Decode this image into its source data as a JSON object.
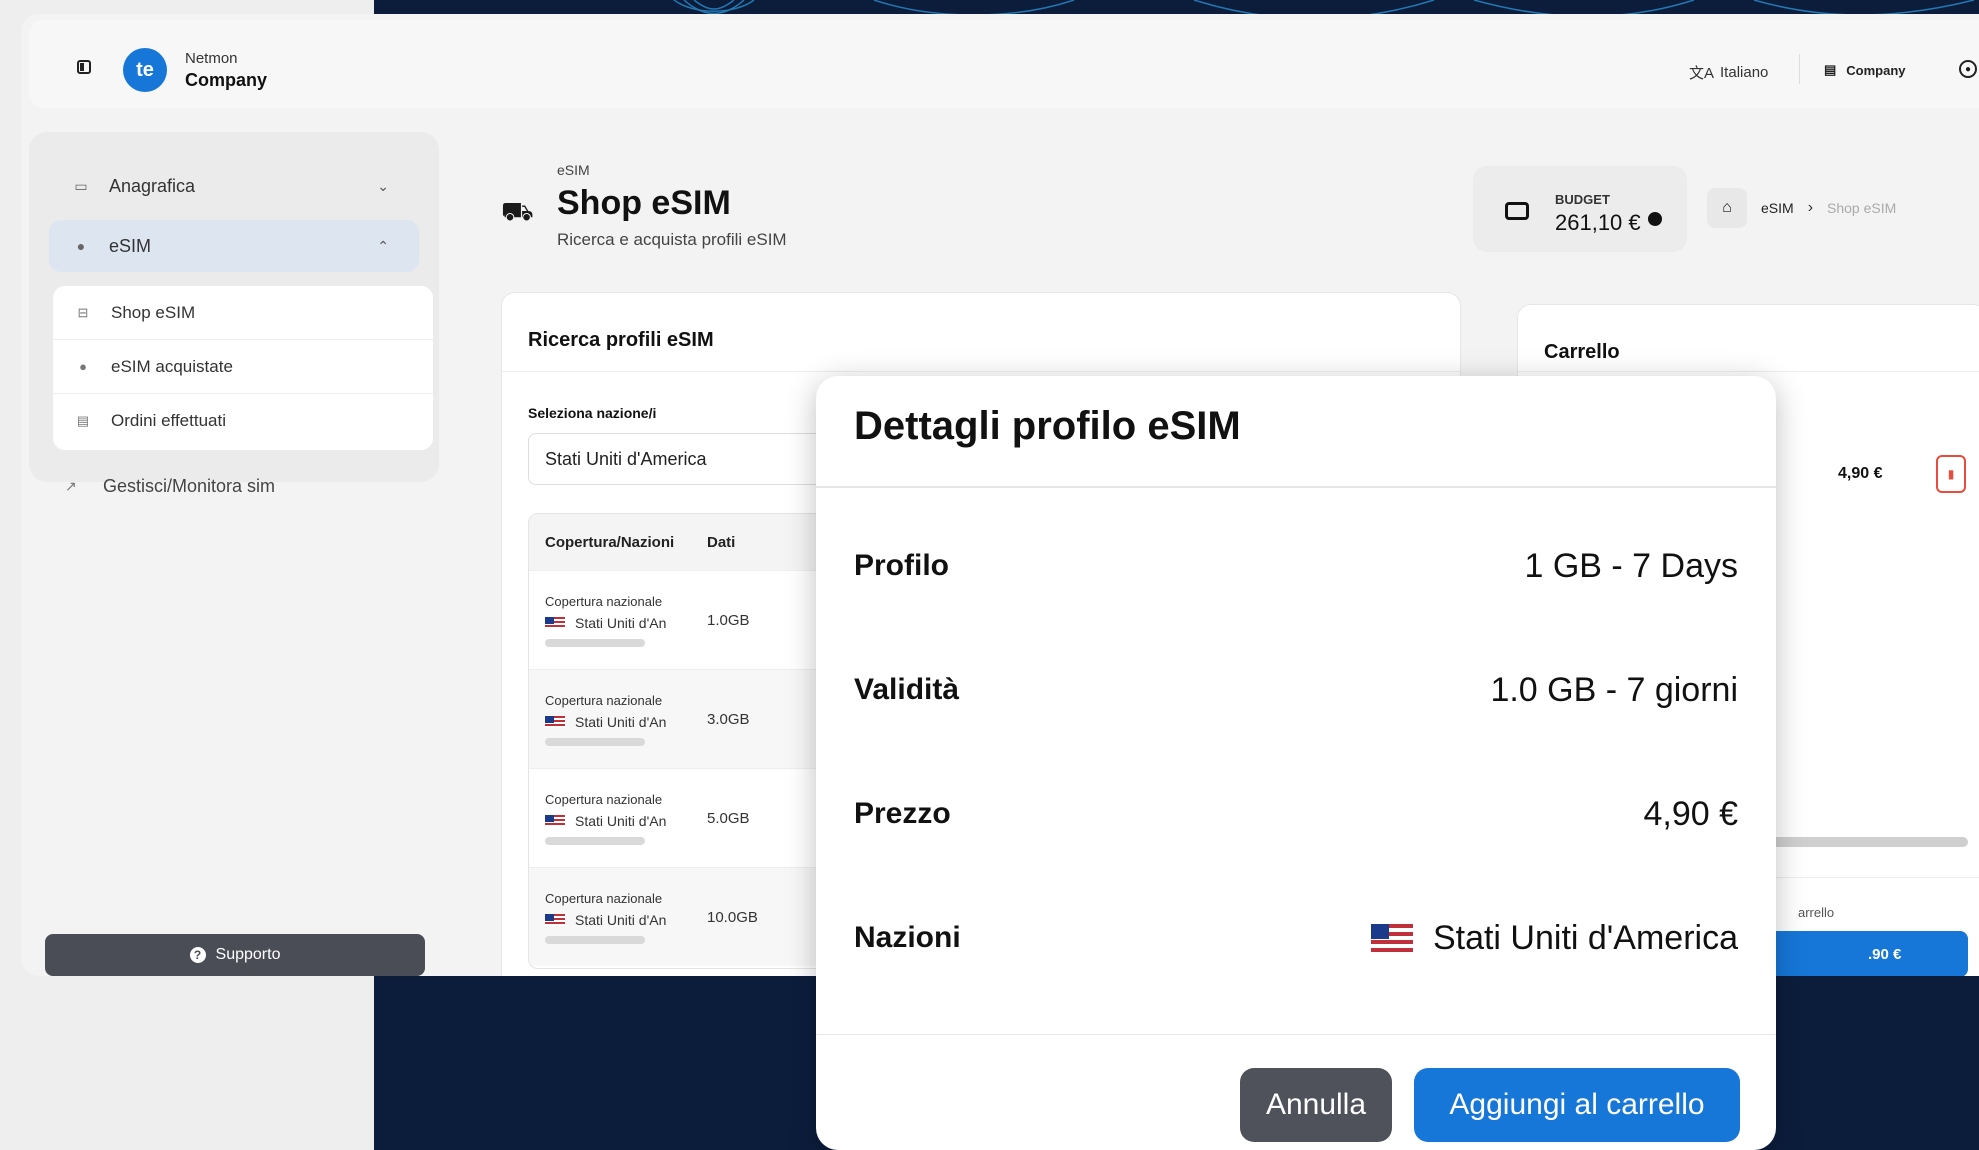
{
  "header": {
    "brand_top": "Netmon",
    "brand_name": "Company",
    "language": "Italiano",
    "company": "Company"
  },
  "sidebar": {
    "items": [
      {
        "label": "Anagrafica"
      },
      {
        "label": "eSIM"
      }
    ],
    "sub_items": [
      {
        "label": "Shop eSIM"
      },
      {
        "label": "eSIM acquistate"
      },
      {
        "label": "Ordini effettuati"
      }
    ],
    "gestisci": "Gestisci/Monitora sim",
    "support": "Supporto"
  },
  "page": {
    "crumb_small": "eSIM",
    "title": "Shop eSIM",
    "subtitle": "Ricerca e acquista profili eSIM"
  },
  "budget": {
    "label": "BUDGET",
    "value": "261,10 €"
  },
  "breadcrumb": {
    "level1": "eSIM",
    "level2": "Shop eSIM"
  },
  "search": {
    "title": "Ricerca profili eSIM",
    "select_label": "Seleziona nazione/i",
    "selected_country": "Stati Uniti d'America",
    "columns": [
      "Copertura/Nazioni",
      "Dati"
    ],
    "rows": [
      {
        "coverage": "Copertura nazionale",
        "country": "Stati Uniti d'An",
        "data": "1.0GB"
      },
      {
        "coverage": "Copertura nazionale",
        "country": "Stati Uniti d'An",
        "data": "3.0GB"
      },
      {
        "coverage": "Copertura nazionale",
        "country": "Stati Uniti d'An",
        "data": "5.0GB"
      },
      {
        "coverage": "Copertura nazionale",
        "country": "Stati Uniti d'An",
        "data": "10.0GB"
      }
    ]
  },
  "cart": {
    "title": "Carrello",
    "item_price": "4,90 €",
    "note": "arrello",
    "button_label": ".90 €"
  },
  "modal": {
    "title": "Dettagli profilo eSIM",
    "rows": [
      {
        "label": "Profilo",
        "value": "1 GB - 7 Days"
      },
      {
        "label": "Validità",
        "value": "1.0 GB - 7 giorni"
      },
      {
        "label": "Prezzo",
        "value": "4,90 €"
      },
      {
        "label": "Nazioni",
        "value": "Stati Uniti d'America"
      }
    ],
    "cancel_label": "Annulla",
    "add_label": "Aggiungi al carrello"
  },
  "colors": {
    "navy_bg": "#0c1d3c",
    "primary": "#1677d8",
    "dark_button": "#4f525a",
    "danger": "#e74c3c"
  }
}
